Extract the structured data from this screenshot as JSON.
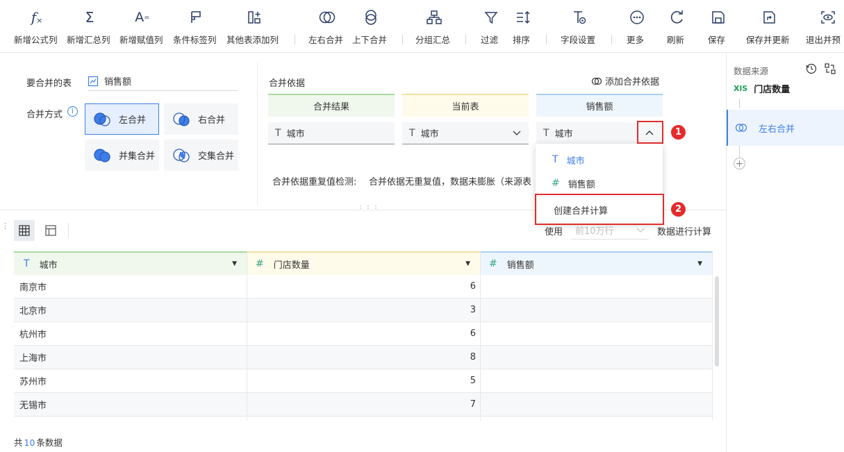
{
  "toolbar": {
    "items": [
      {
        "label": "新增公式列",
        "icon": "formula-icon"
      },
      {
        "label": "新增汇总列",
        "icon": "sigma-icon"
      },
      {
        "label": "新增赋值列",
        "icon": "assign-icon"
      },
      {
        "label": "条件标签列",
        "icon": "flag-icon"
      },
      {
        "label": "其他表添加列",
        "icon": "add-column-icon"
      },
      {
        "label": "左右合并",
        "icon": "merge-lr-icon"
      },
      {
        "label": "上下合并",
        "icon": "merge-ud-icon"
      },
      {
        "label": "分组汇总",
        "icon": "group-icon"
      },
      {
        "label": "过滤",
        "icon": "filter-icon"
      },
      {
        "label": "排序",
        "icon": "sort-icon"
      },
      {
        "label": "字段设置",
        "icon": "field-settings-icon"
      },
      {
        "label": "更多",
        "icon": "more-icon"
      },
      {
        "label": "刷新",
        "icon": "refresh-icon"
      },
      {
        "label": "保存",
        "icon": "save-icon"
      },
      {
        "label": "保存并更新",
        "icon": "save-update-icon"
      },
      {
        "label": "退出并预",
        "icon": "exit-preview-icon"
      }
    ]
  },
  "config": {
    "merge_table_label": "要合并的表",
    "merge_table_value": "销售额",
    "merge_mode_label": "合并方式",
    "modes": [
      "左合并",
      "右合并",
      "并集合并",
      "交集合并"
    ],
    "basis_label": "合并依据",
    "add_basis_label": "添加合并依据",
    "col_headers": [
      "合并结果",
      "当前表",
      "销售额"
    ],
    "fields": [
      "城市",
      "城市",
      "城市"
    ],
    "dup_check_label": "合并依据重复值检测:",
    "dup_check_value": "合并依据无重复值，数据未膨胀（来源表",
    "accent": "#3d7eea"
  },
  "dropdown": {
    "options": [
      "城市",
      "销售额"
    ],
    "create_label": "创建合并计算"
  },
  "annotations": [
    "1",
    "2"
  ],
  "preview": {
    "use_label": "使用",
    "rows_select": "前10万行",
    "calc_label": "数据进行计算",
    "columns": [
      "城市",
      "门店数量",
      "销售额"
    ],
    "rows": [
      [
        "南京市",
        "6",
        ""
      ],
      [
        "北京市",
        "3",
        ""
      ],
      [
        "杭州市",
        "6",
        ""
      ],
      [
        "上海市",
        "8",
        ""
      ],
      [
        "苏州市",
        "5",
        ""
      ],
      [
        "无锡市",
        "7",
        ""
      ]
    ],
    "footer_prefix": "共",
    "footer_count": "10",
    "footer_suffix": "条数据"
  },
  "right_panel": {
    "title": "数据来源",
    "source_badge": "XlS",
    "source_name": "门店数量",
    "step": "左右合并"
  }
}
